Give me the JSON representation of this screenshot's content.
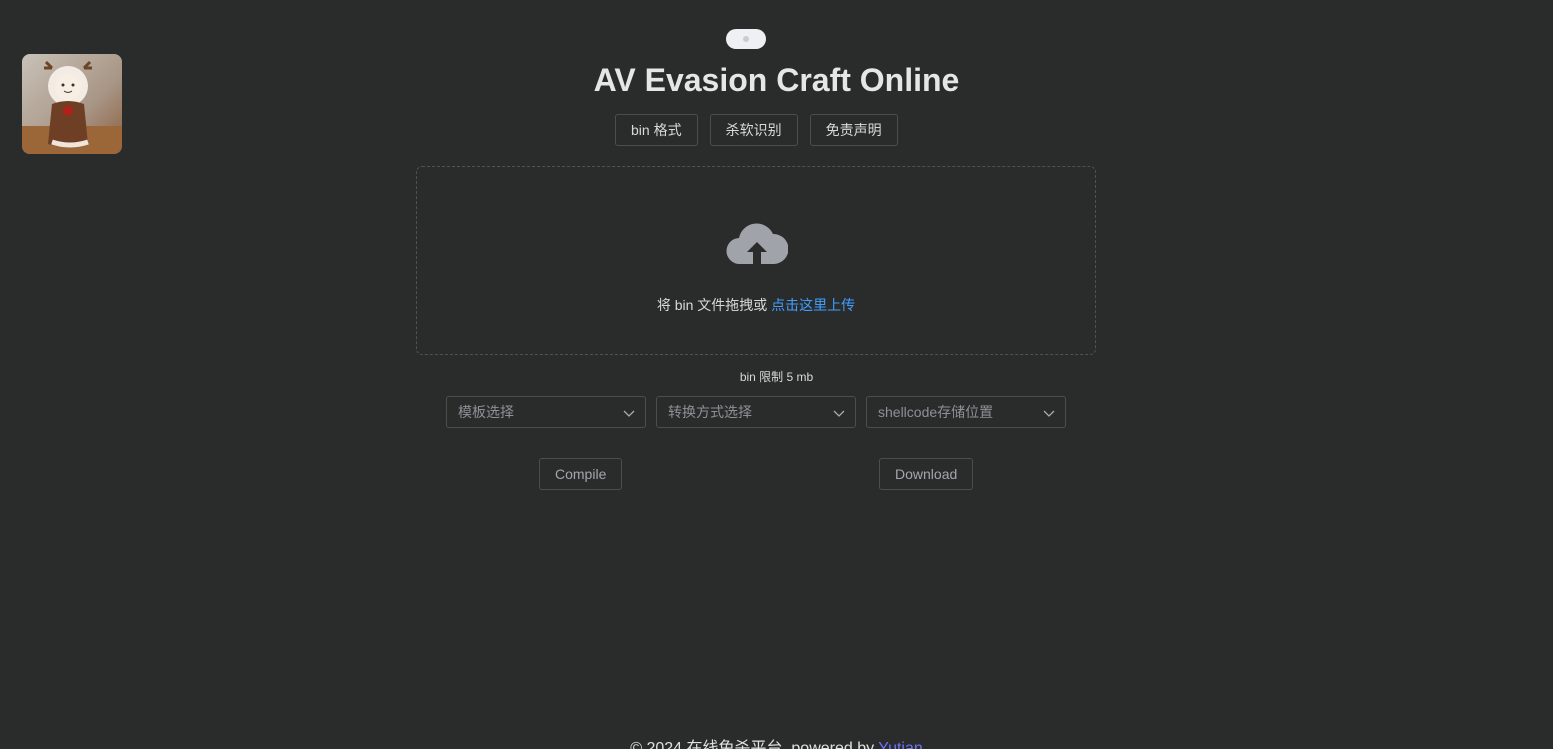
{
  "header": {
    "title": "AV Evasion Craft Online",
    "nav": [
      "bin 格式",
      "杀软识别",
      "免责声明"
    ]
  },
  "upload": {
    "icon": "cloud-upload-icon",
    "hint_text": "将 bin 文件拖拽或 ",
    "hint_link": "点击这里上传",
    "limit": "bin 限制 5 mb"
  },
  "selects": [
    {
      "placeholder": "模板选择"
    },
    {
      "placeholder": "转换方式选择"
    },
    {
      "placeholder": "shellcode存储位置"
    }
  ],
  "actions": {
    "compile": "Compile",
    "download": "Download"
  },
  "footer": {
    "text": "© 2024 在线免杀平台, powered by ",
    "author": "Yutian"
  },
  "colors": {
    "background": "#2a2c2c",
    "link": "#409eff",
    "author": "#6d72ff"
  }
}
